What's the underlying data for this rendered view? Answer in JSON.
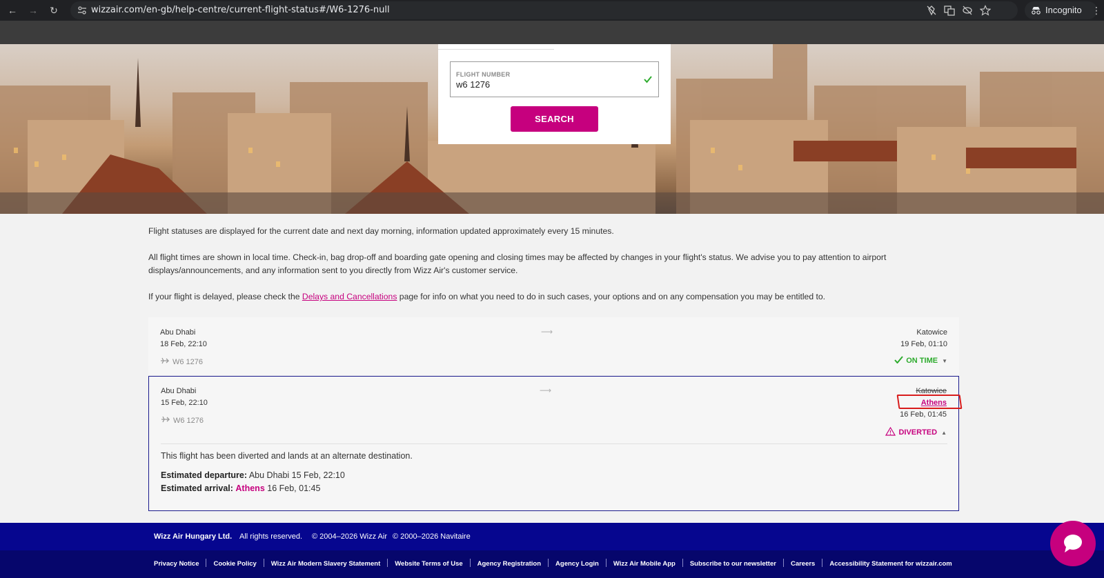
{
  "browser": {
    "url": "wizzair.com/en-gb/help-centre/current-flight-status#/W6-1276-null",
    "profile": "Incognito"
  },
  "search": {
    "field_label": "FLIGHT NUMBER",
    "field_value": "w6 1276",
    "button_label": "SEARCH"
  },
  "info": {
    "line1": "Flight statuses are displayed for the current date and next day morning, information updated approximately every 15 minutes.",
    "line2": "All flight times are shown in local time. Check-in, bag drop-off and boarding gate opening and closing times may be affected by changes in your flight's status. We advise you to pay attention to airport displays/announcements, and any information sent to you directly from Wizz Air's customer service.",
    "line3_before": "If your flight is delayed, please check the ",
    "line3_link": "Delays and Cancellations",
    "line3_after": " page for info on what you need to do in such cases, your options and on any compensation you may be entitled to."
  },
  "flights": [
    {
      "origin": "Abu Dhabi",
      "departure": "18 Feb, 22:10",
      "destination": "Katowice",
      "arrival": "19 Feb, 01:10",
      "flight_number": "W6 1276",
      "status": "ON TIME"
    },
    {
      "origin": "Abu Dhabi",
      "departure": "15 Feb, 22:10",
      "original_destination": "Katowice",
      "destination": "Athens",
      "arrival": "16 Feb, 01:45",
      "flight_number": "W6 1276",
      "status": "DIVERTED",
      "details": {
        "message": "This flight has been diverted and lands at an alternate destination.",
        "est_departure_label": "Estimated departure:",
        "est_departure_value": "Abu Dhabi 15 Feb, 22:10",
        "est_arrival_label": "Estimated arrival:",
        "est_arrival_city": "Athens",
        "est_arrival_time": "16 Feb, 01:45"
      }
    }
  ],
  "footer": {
    "company": "Wizz Air Hungary Ltd.",
    "rights": "All rights reserved.",
    "copyright1": "© 2004–2026 Wizz Air",
    "copyright2": "© 2000–2026 Navitaire",
    "links": [
      "Privacy Notice",
      "Cookie Policy",
      "Wizz Air Modern Slavery Statement",
      "Website Terms of Use",
      "Agency Registration",
      "Agency Login",
      "Wizz Air Mobile App",
      "Subscribe to our newsletter",
      "Careers",
      "Accessibility Statement for wizzair.com"
    ]
  },
  "colors": {
    "brand_magenta": "#c6007e",
    "footer_navy": "#06068f",
    "on_time_green": "#2dab2d"
  }
}
